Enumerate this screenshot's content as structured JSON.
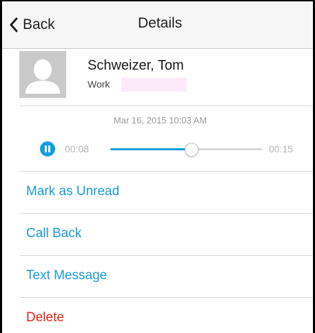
{
  "nav": {
    "back_label": "Back",
    "title": "Details"
  },
  "contact": {
    "name": "Schweizer, Tom",
    "type": "Work"
  },
  "message": {
    "timestamp": "Mar 16, 2015 10:03 AM"
  },
  "player": {
    "elapsed": "00:08",
    "total": "00:15",
    "progress_fraction": 0.53,
    "state_icon": "pause-icon"
  },
  "actions": {
    "mark_unread": "Mark as Unread",
    "call_back": "Call Back",
    "text_message": "Text Message",
    "delete": "Delete"
  },
  "colors": {
    "accent": "#0d9fe0",
    "link": "#1a9bd8",
    "destructive": "#e0231c"
  }
}
